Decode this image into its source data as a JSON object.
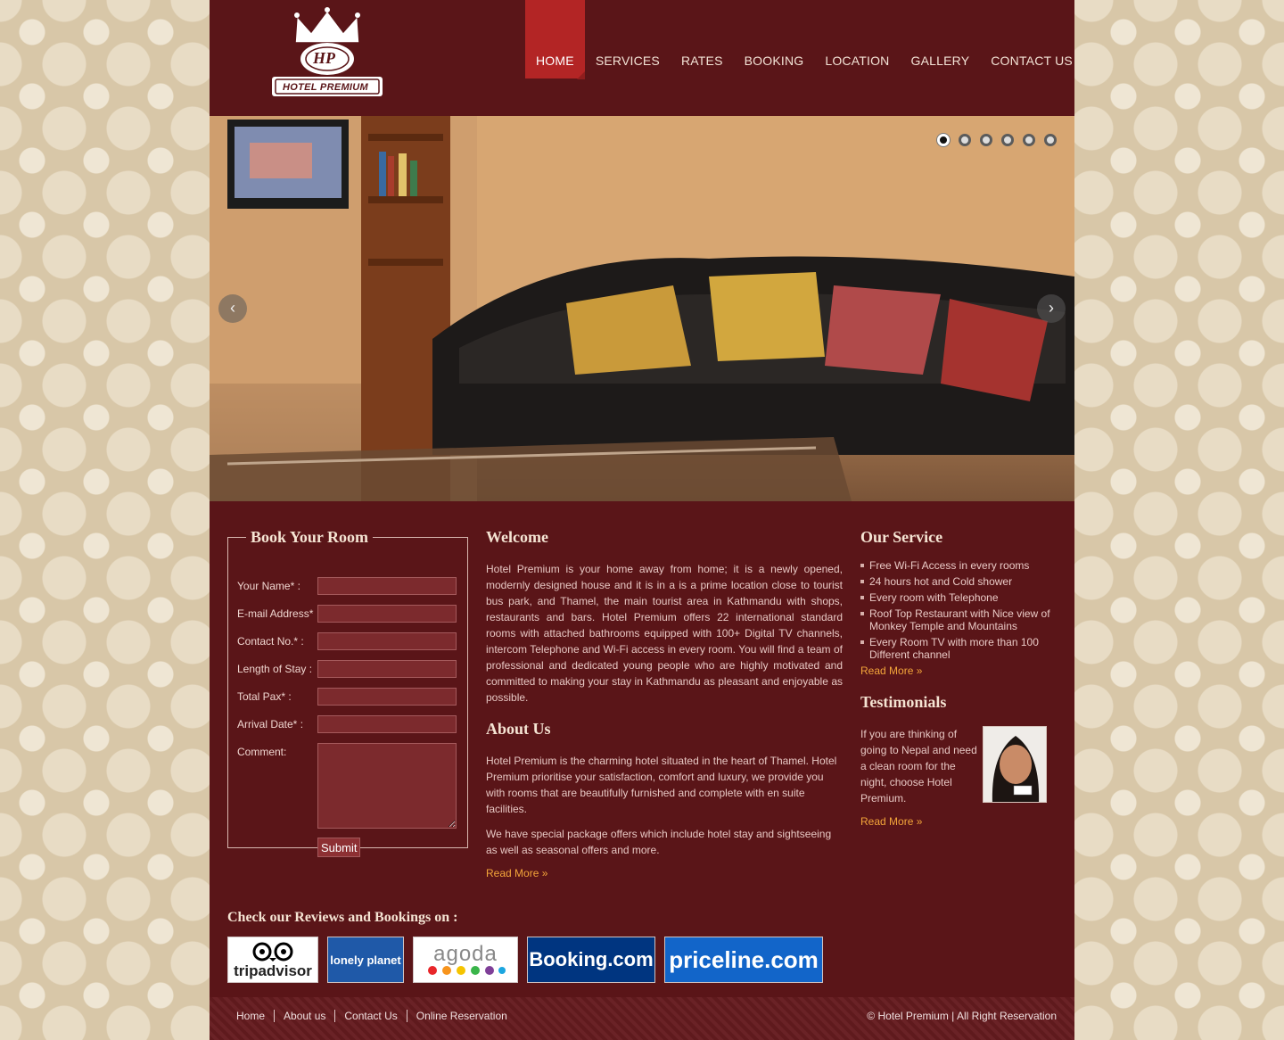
{
  "header": {
    "logo_text": "HOTEL PREMIUM",
    "logo_monogram": "HP",
    "nav": [
      "HOME",
      "SERVICES",
      "RATES",
      "BOOKING",
      "LOCATION",
      "GALLERY",
      "CONTACT US"
    ],
    "active_nav": "HOME"
  },
  "slider": {
    "slide_count": 6,
    "active_slide": 1,
    "prev_icon": "chevron-left-icon",
    "next_icon": "chevron-right-icon"
  },
  "booking": {
    "title": "Book Your Room",
    "fields": {
      "name": "Your Name* :",
      "email": "E-mail Address*",
      "contact": "Contact No.* :",
      "stay": "Length of Stay :",
      "pax": "Total Pax* :",
      "arrival": "Arrival Date* :",
      "comment": "Comment:"
    },
    "submit_label": "Submit"
  },
  "welcome": {
    "title": "Welcome",
    "text": "Hotel Premium is your home away from home; it is a newly opened, modernly designed house and it is in a is a prime location close to tourist bus park, and Thamel, the main tourist area in Kathmandu with shops, restaurants and bars.  Hotel Premium offers 22 international standard rooms with attached bathrooms equipped with 100+ Digital TV channels, intercom Telephone and Wi-Fi access in every room. You will find a team of professional and dedicated young people who are highly motivated and committed to making your stay in Kathmandu as pleasant and enjoyable as possible."
  },
  "about": {
    "title": "About Us",
    "para1": "Hotel Premium is the charming hotel situated in the heart of Thamel. Hotel Premium prioritise your satisfaction, comfort and luxury, we provide you with rooms that are beautifully furnished and complete with en suite facilities.",
    "para2": "We have special package offers which include hotel stay and sightseeing as well as seasonal offers and more.",
    "read_more": "Read More »"
  },
  "service": {
    "title": "Our Service",
    "items": [
      "Free Wi-Fi Access in every rooms",
      "24 hours hot and Cold shower",
      "Every room with Telephone",
      "Roof Top Restaurant with Nice view of Monkey Temple and Mountains",
      "Every Room TV with more than 100 Different channel"
    ],
    "read_more": "Read More »"
  },
  "testimonials": {
    "title": "Testimonials",
    "text": "If you are thinking of going to Nepal and need a clean room for the night, choose Hotel Premium.",
    "read_more": "Read More »"
  },
  "reviews": {
    "title": "Check our Reviews and Bookings on :",
    "partners": [
      {
        "name": "tripadvisor",
        "color": "#ffffff"
      },
      {
        "name": "lonely planet",
        "color": "#1f59a8"
      },
      {
        "name": "agoda",
        "color": "#ffffff"
      },
      {
        "name": "Booking.com",
        "color": "#003580"
      },
      {
        "name": "priceline.com",
        "color": "#1265c9"
      }
    ]
  },
  "footer": {
    "links": [
      "Home",
      "About us",
      "Contact Us",
      "Online Reservation"
    ],
    "copyright": "© Hotel Premium | All Right Reservation"
  },
  "colors": {
    "brand_maroon": "#5a1518",
    "nav_active": "#b32525",
    "link_orange": "#f3a53a"
  }
}
